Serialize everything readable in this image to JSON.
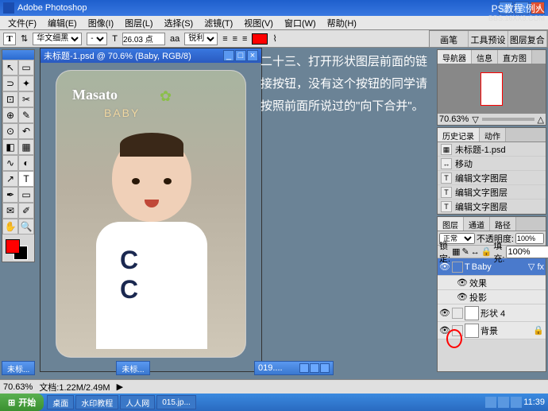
{
  "app": {
    "title": "Adobe Photoshop"
  },
  "watermark": "PS教程:例人",
  "bbsurl": "BBS.16XX8.COM",
  "menu": {
    "items": [
      "文件(F)",
      "编辑(E)",
      "图像(I)",
      "图层(L)",
      "选择(S)",
      "滤镜(T)",
      "视图(V)",
      "窗口(W)",
      "帮助(H)"
    ]
  },
  "options": {
    "font_family": "华文细黑",
    "font_size": "26.03 点",
    "aa": "aa",
    "sharp": "锐利",
    "color": "#ff0000"
  },
  "presets": {
    "tabs": [
      "画笔",
      "工具预设",
      "图层复合"
    ]
  },
  "doc": {
    "title": "未标题-1.psd @ 70.6% (Baby, RGB/8)",
    "text_masato": "Masato",
    "text_baby": "BABY"
  },
  "doc2": {
    "title": "019...."
  },
  "tutorial": "二十三、打开形状图层前面的链接按钮，没有这个按钮的同学请按照前面所说过的\"向下合并\"。",
  "navigator": {
    "tabs": [
      "导航器",
      "信息",
      "直方图"
    ],
    "zoom": "70.63%"
  },
  "history": {
    "tabs": [
      "历史记录",
      "动作"
    ],
    "items": [
      {
        "icon": "img",
        "label": "未标题-1.psd"
      },
      {
        "icon": "↔",
        "label": "移动"
      },
      {
        "icon": "T",
        "label": "编辑文字图层"
      },
      {
        "icon": "T",
        "label": "编辑文字图层"
      },
      {
        "icon": "T",
        "label": "编辑文字图层"
      }
    ]
  },
  "layers": {
    "tabs": [
      "图层",
      "通道",
      "路径"
    ],
    "mode": "正常",
    "opacity_label": "不透明度:",
    "opacity": "100%",
    "lock_label": "锁定:",
    "fill_label": "填充:",
    "fill": "100%",
    "items": [
      {
        "name": "Baby",
        "sel": true,
        "fx": true
      },
      {
        "name": "效果",
        "sub": true
      },
      {
        "name": "投影",
        "sub": true
      },
      {
        "name": "形状 4"
      },
      {
        "name": "背景",
        "locked": true
      }
    ]
  },
  "status": {
    "zoom": "70.63%",
    "docsize": "文档:1.22M/2.49M"
  },
  "tabs": {
    "items": [
      "未标...",
      "未标..."
    ]
  },
  "taskbar": {
    "start": "开始",
    "items": [
      "桌面",
      "水印教程",
      "人人网",
      "015.jp..."
    ],
    "time": "11:39"
  }
}
